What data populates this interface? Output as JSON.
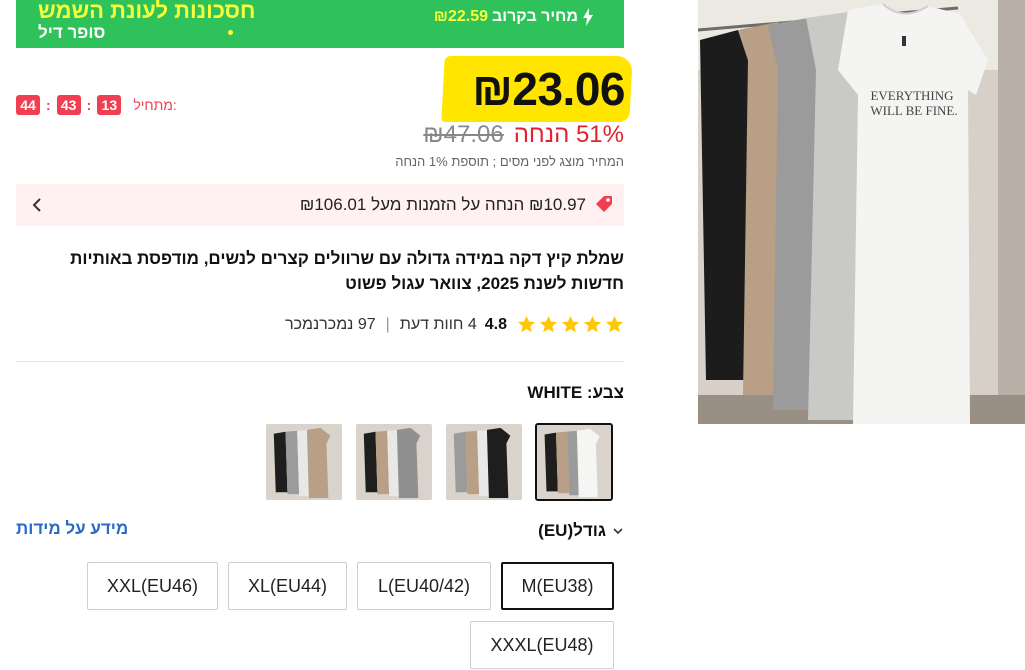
{
  "banner": {
    "title": "חסכונות לעונת השמש",
    "subtitle": "סופר דיל",
    "upcoming_label": "מחיר בקרוב",
    "upcoming_price": "₪22.59",
    "background": "#2fc25b",
    "accent": "#f7ff3a"
  },
  "countdown": {
    "label": "מתחיל:",
    "hours": "13",
    "minutes": "43",
    "seconds": "44",
    "sep": ":"
  },
  "price": {
    "current": "₪23.06",
    "original": "₪47.06",
    "discount": "51% הנחה",
    "note": "המחיר מוצג לפני מסים ; תוספת 1% הנחה",
    "highlight_color": "#ffe500",
    "discount_color": "#e0232f"
  },
  "coupon": {
    "text": "₪10.97 הנחה על הזמנות מעל ₪106.01"
  },
  "product": {
    "title": "שמלת קיץ דקה במידה גדולה עם שרוולים קצרים לנשים, מודפסת באותיות חדשות לשנת 2025, צוואר עגול פשוט",
    "image_print_line1": "EVERYTHING",
    "image_print_line2": "WILL BE FINE."
  },
  "rating": {
    "score": "4.8",
    "stars": 5,
    "reviews": "4 חוות דעת",
    "sold": "97 נמכרנמכר",
    "star_color": "#ffc700"
  },
  "color": {
    "label": "צבע: WHITE",
    "selected": "WHITE",
    "icons": [
      "swatch-image-white",
      "swatch-image-black",
      "swatch-image-gray",
      "swatch-image-khaki"
    ]
  },
  "size": {
    "label": "גודל(EU)",
    "guide_link": "מידע על מידות",
    "options": [
      "M(EU38)",
      "L(EU40/42)",
      "XL(EU44)",
      "XXL(EU46)",
      "XXXL(EU48)"
    ],
    "selected": "M(EU38)",
    "link_color": "#2a6ac8"
  }
}
